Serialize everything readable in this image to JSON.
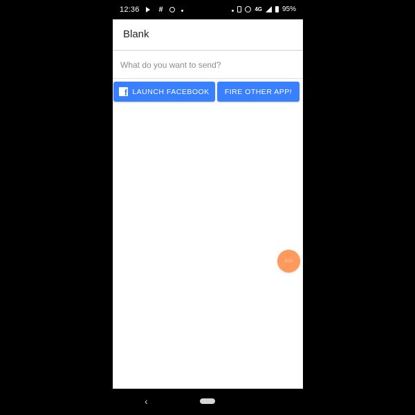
{
  "status_bar": {
    "time": "12:36",
    "network": "4G",
    "battery": "95%",
    "icons_left": [
      "play-icon",
      "hash-icon",
      "pokeball-icon",
      "dot-icon"
    ],
    "icons_right": [
      "dot-icon",
      "vibrate-icon",
      "hotspot-icon",
      "signal-icon",
      "battery-icon"
    ]
  },
  "app": {
    "title": "Blank",
    "input": {
      "placeholder": "What do you want to send?",
      "value": ""
    },
    "buttons": {
      "facebook_label": "LAUNCH FACEBOOK",
      "other_label": "FIRE OTHER APP!"
    },
    "fab_text": "Acts",
    "colors": {
      "primary": "#3880ff",
      "fab": "#ff9a5c",
      "background": "#ffffff"
    }
  },
  "nav": {
    "back_glyph": "‹"
  }
}
